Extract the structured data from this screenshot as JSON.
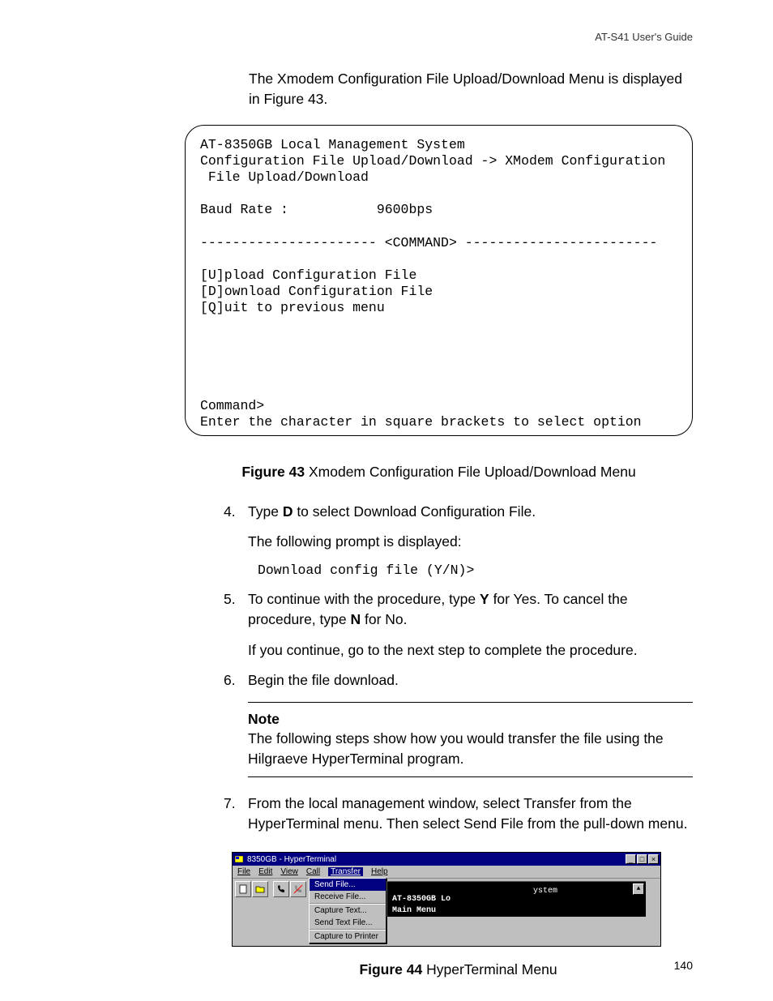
{
  "header": {
    "guide": "AT-S41 User's Guide"
  },
  "intro": "The Xmodem Configuration File Upload/Download Menu is displayed in Figure 43.",
  "terminal": "AT-8350GB Local Management System\nConfiguration File Upload/Download -> XModem Configuration\n File Upload/Download\n\nBaud Rate :           9600bps\n\n---------------------- <COMMAND> ------------------------\n\n[U]pload Configuration File\n[D]ownload Configuration File\n[Q]uit to previous menu\n\n\n\n\n\nCommand>\nEnter the character in square brackets to select option",
  "fig43": {
    "label": "Figure 43",
    "caption": "  Xmodem Configuration File Upload/Download Menu"
  },
  "step4": {
    "num": "4.",
    "a": "Type ",
    "key": "D",
    "b": " to select Download Configuration File.",
    "sub": "The following prompt is displayed:",
    "code": "Download config file (Y/N)>"
  },
  "step5": {
    "num": "5.",
    "a": "To continue with the procedure, type ",
    "y": "Y",
    "b": " for Yes. To cancel the procedure, type ",
    "n": "N",
    "c": " for No.",
    "sub": "If you continue, go to the next step to complete the procedure."
  },
  "step6": {
    "num": "6.",
    "text": "Begin the file download."
  },
  "note": {
    "label": "Note",
    "text": "The following steps show how you would transfer the file using the Hilgraeve HyperTerminal program."
  },
  "step7": {
    "num": "7.",
    "text": "From the local management window, select Transfer from the HyperTerminal menu. Then select Send File from the pull-down menu."
  },
  "ht": {
    "title": "8350GB - HyperTerminal",
    "menu": {
      "file": "File",
      "edit": "Edit",
      "view": "View",
      "call": "Call",
      "transfer": "Transfer",
      "help": "Help"
    },
    "dropdown": {
      "send": "Send File...",
      "recv": "Receive File...",
      "captxt": "Capture Text...",
      "sendtxt": "Send Text File...",
      "capprn": "Capture to Printer"
    },
    "term": {
      "frag": "ystem",
      "line1": "AT-8350GB Lo",
      "line2": "Main Menu"
    }
  },
  "fig44": {
    "label": "Figure 44",
    "caption": "  HyperTerminal Menu"
  },
  "pagenum": "140"
}
